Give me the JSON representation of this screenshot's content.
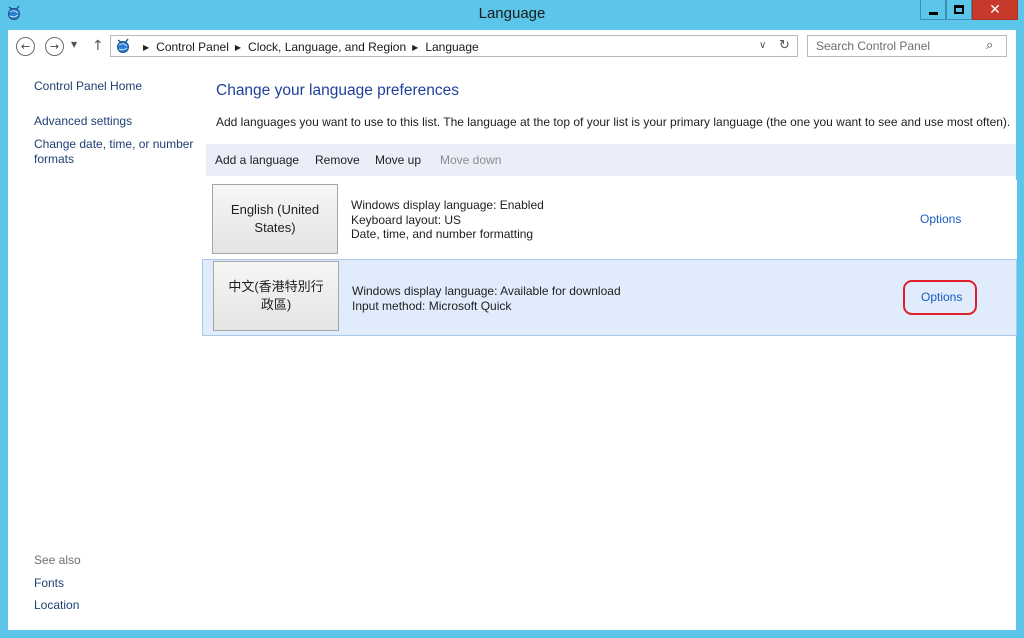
{
  "window": {
    "title": "Language",
    "close_glyph": "✕"
  },
  "nav": {
    "back_glyph": "←",
    "forward_glyph": "→",
    "dropdown_glyph": "▼",
    "up_glyph": "↑",
    "breadcrumbs": [
      "Control Panel",
      "Clock, Language, and Region",
      "Language"
    ],
    "crumb_separator": "▶",
    "address_dropdown_glyph": "∨",
    "refresh_glyph": "↻",
    "search_placeholder": "Search Control Panel",
    "search_glyph": "⌕"
  },
  "sidebar": {
    "home": "Control Panel Home",
    "advanced": "Advanced settings",
    "date_time": "Change date, time, or number formats",
    "see_also": "See also",
    "fonts": "Fonts",
    "location": "Location"
  },
  "main": {
    "heading": "Change your language preferences",
    "description": "Add languages you want to use to this list. The language at the top of your list is your primary language (the one you want to see and use most often).",
    "toolbar": {
      "add": "Add a language",
      "remove": "Remove",
      "move_up": "Move up",
      "move_down": "Move down"
    },
    "languages": [
      {
        "name": "English (United States)",
        "details": [
          "Windows display language: Enabled",
          "Keyboard layout: US",
          "Date, time, and number formatting"
        ],
        "options": "Options"
      },
      {
        "name": "中文(香港特別行政區)",
        "details": [
          "Windows display language: Available for download",
          "Input method: Microsoft Quick"
        ],
        "options": "Options",
        "selected": true
      }
    ]
  },
  "colors": {
    "title_bar": "#5cc6ea",
    "close_button": "#c7392b",
    "link": "#1e3f73",
    "heading": "#1e3f9c",
    "options_link": "#1a5bc4",
    "selected_row": "#e0ecfc",
    "highlight_ring": "#e0202a"
  }
}
